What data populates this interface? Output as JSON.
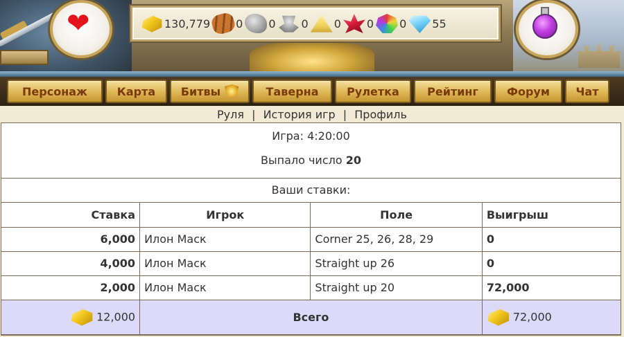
{
  "resources": [
    {
      "icon": "gold-bars-icon",
      "value": "130,779"
    },
    {
      "icon": "wood-icon",
      "value": "0"
    },
    {
      "icon": "stone-icon",
      "value": "0"
    },
    {
      "icon": "iron-icon",
      "value": "0"
    },
    {
      "icon": "sand-icon",
      "value": "0"
    },
    {
      "icon": "ruby-icon",
      "value": "0"
    },
    {
      "icon": "gems-icon",
      "value": "0"
    },
    {
      "icon": "diamond-icon",
      "value": "55"
    }
  ],
  "nav": {
    "character": "Персонаж",
    "map": "Карта",
    "battles": "Битвы",
    "tavern": "Таверна",
    "roulette": "Рулетка",
    "rating": "Рейтинг",
    "forum": "Форум",
    "chat": "Чат"
  },
  "subnav": {
    "roulette": "Руля",
    "history": "История игр",
    "profile": "Профиль",
    "separator": "|"
  },
  "game": {
    "time_label": "Игра: 4:20:00",
    "result_label": "Выпало число",
    "result_number": "20",
    "bets_title": "Ваши ставки:"
  },
  "table": {
    "headers": {
      "stake": "Ставка",
      "player": "Игрок",
      "field": "Поле",
      "win": "Выигрыш"
    },
    "rows": [
      {
        "stake": "6,000",
        "player": "Илон Маск",
        "field": "Corner 25, 26, 28, 29",
        "win": "0"
      },
      {
        "stake": "4,000",
        "player": "Илон Маск",
        "field": "Straight up 26",
        "win": "0"
      },
      {
        "stake": "2,000",
        "player": "Илон Маск",
        "field": "Straight up 20",
        "win": "72,000"
      }
    ],
    "total": {
      "stake": "12,000",
      "label": "Всего",
      "win": "72,000"
    }
  },
  "colors": {
    "nav_text": "#7a3a0a",
    "total_row_bg": "#dcdaf8",
    "heart": "#e3141c",
    "potion": "#c13ee0"
  }
}
